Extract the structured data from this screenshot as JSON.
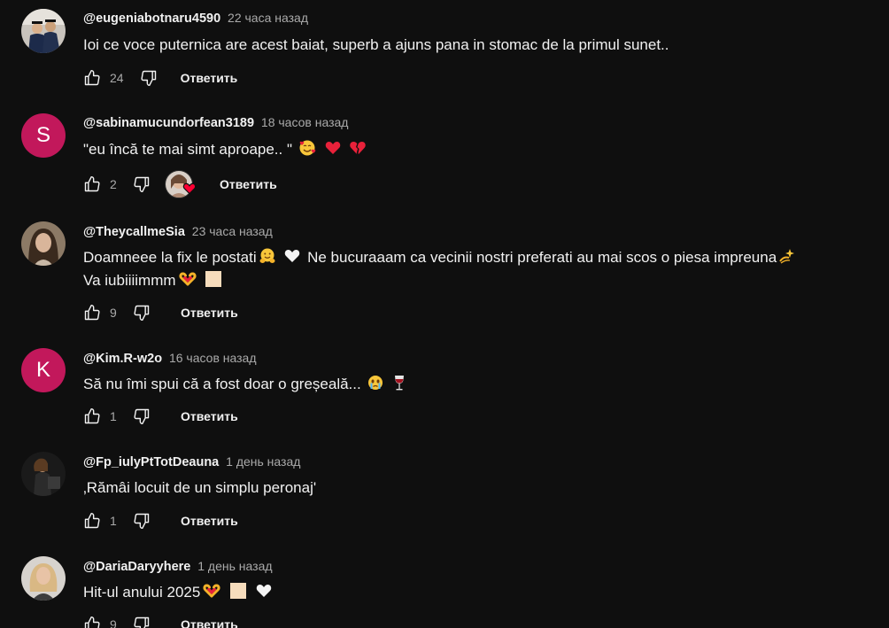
{
  "colors": {
    "background": "#0f0f0f",
    "text": "#f1f1f1",
    "muted": "#aaaaaa",
    "avatar_s": "#c2185b",
    "avatar_k": "#c2185b",
    "heart": "#ff0033"
  },
  "comments": [
    {
      "author": "@eugeniabotnaru4590",
      "time": "22 часа назад",
      "text": "Ioi ce voce puternica are acest baiat, superb a ajuns pana in stomac de la primul sunet..",
      "likes": "24",
      "reply": "Ответить",
      "avatar": "photo-graduates"
    },
    {
      "author": "@sabinamucundorfean3189",
      "time": "18 часов назад",
      "text": "\"eu încă te mai simt aproape.. \"",
      "likes": "2",
      "reply": "Ответить",
      "avatar_letter": "S",
      "emojis": [
        "smiling-face-with-hearts-emoji",
        "red-heart-emoji",
        "broken-heart-emoji"
      ],
      "creator_heart": true
    },
    {
      "author": "@TheycallmeSia",
      "time": "23 часа назад",
      "text_line1_a": "Doamneee la fix le postati",
      "text_line1_b": "Ne bucuraaam ca vecinii nostri preferati au mai scos o piesa impreuna",
      "text_line2": "Va iubiiiimmm",
      "likes": "9",
      "reply": "Ответить",
      "avatar": "photo-portrait",
      "emojis": [
        "hugging-face-emoji",
        "white-heart-emoji",
        "dizzy-emoji",
        "heart-hands-emoji",
        "light-skin-tone-square-emoji"
      ]
    },
    {
      "author": "@Kim.R-w2o",
      "time": "16 часов назад",
      "text": "Să nu îmi spui că a fost doar o greșeală...",
      "likes": "1",
      "reply": "Ответить",
      "avatar_letter": "K",
      "emojis": [
        "crying-face-emoji",
        "wine-glass-emoji"
      ]
    },
    {
      "author": "@Fp_iulyPtTotDeauna",
      "time": "1 день назад",
      "text": "‚Rămâi locuit de un simplu peronaj'",
      "likes": "1",
      "reply": "Ответить",
      "avatar": "photo-dark"
    },
    {
      "author": "@DariaDaryyhere",
      "time": "1 день назад",
      "text": "Hit-ul anului 2025",
      "likes": "9",
      "reply": "Ответить",
      "avatar": "photo-blonde",
      "emojis": [
        "heart-hands-emoji",
        "light-skin-tone-square-emoji",
        "white-heart-emoji"
      ]
    }
  ]
}
